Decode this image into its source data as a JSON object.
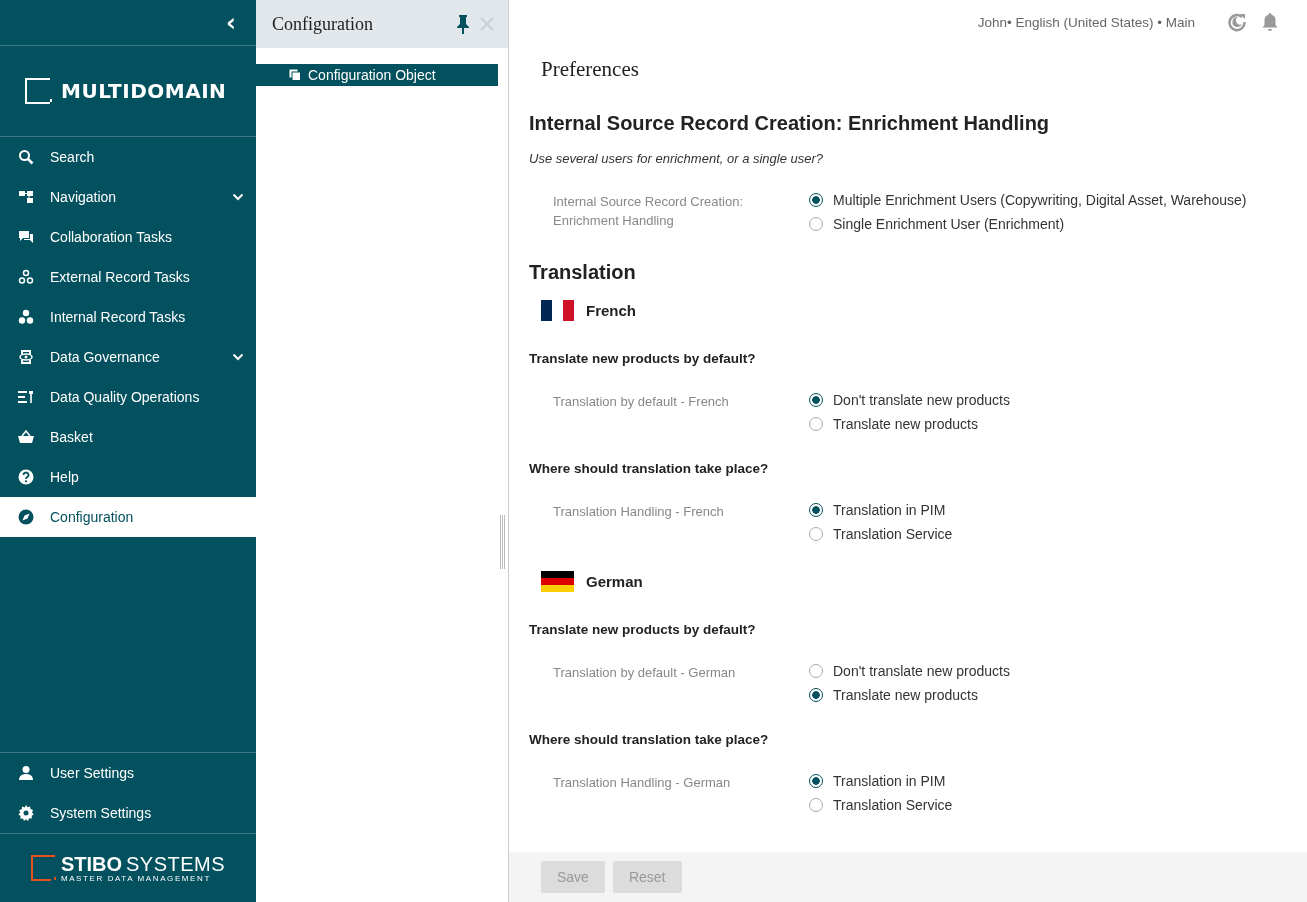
{
  "sidebar": {
    "collapse_glyph": "‹",
    "brand": "MULTIDOMAIN",
    "items": [
      {
        "label": "Search",
        "expandable": false,
        "selected": false
      },
      {
        "label": "Navigation",
        "expandable": true,
        "selected": false
      },
      {
        "label": "Collaboration Tasks",
        "expandable": false,
        "selected": false
      },
      {
        "label": "External Record Tasks",
        "expandable": false,
        "selected": false
      },
      {
        "label": "Internal Record Tasks",
        "expandable": false,
        "selected": false
      },
      {
        "label": "Data Governance",
        "expandable": true,
        "selected": false
      },
      {
        "label": "Data Quality Operations",
        "expandable": false,
        "selected": false
      },
      {
        "label": "Basket",
        "expandable": false,
        "selected": false
      },
      {
        "label": "Help",
        "expandable": false,
        "selected": false
      },
      {
        "label": "Configuration",
        "expandable": false,
        "selected": true
      }
    ],
    "bottom_items": [
      {
        "label": "User Settings"
      },
      {
        "label": "System Settings"
      }
    ],
    "footer_logo": {
      "primary": "STIBO",
      "secondary": "SYSTEMS",
      "tagline": "MASTER DATA MANAGEMENT"
    }
  },
  "panel": {
    "title": "Configuration",
    "pinned": true,
    "tree": [
      {
        "label": "Configuration Object",
        "selected": true
      }
    ]
  },
  "top_bar": {
    "context": "John• English (United States) • Main"
  },
  "page": {
    "title": "Preferences",
    "blocks": [
      {
        "kind": "heading",
        "text": "Internal Source Record Creation: Enrichment Handling"
      },
      {
        "kind": "description",
        "text": "Use several users for enrichment, or a single user?"
      },
      {
        "kind": "setting",
        "label": "Internal Source Record Creation: Enrichment Handling",
        "options": [
          {
            "label": "Multiple Enrichment Users (Copywriting, Digital Asset, Warehouse)",
            "selected": true
          },
          {
            "label": "Single Enrichment User (Enrichment)",
            "selected": false
          }
        ]
      },
      {
        "kind": "heading",
        "text": "Translation"
      },
      {
        "kind": "language",
        "text": "French"
      },
      {
        "kind": "question",
        "text": "Translate new products by default?"
      },
      {
        "kind": "setting",
        "label": "Translation by default - French",
        "options": [
          {
            "label": "Don't translate new products",
            "selected": true
          },
          {
            "label": "Translate new products",
            "selected": false
          }
        ]
      },
      {
        "kind": "question",
        "text": "Where should translation take place?"
      },
      {
        "kind": "setting",
        "label": "Translation Handling - French",
        "options": [
          {
            "label": "Translation in PIM",
            "selected": true
          },
          {
            "label": "Translation Service",
            "selected": false
          }
        ]
      },
      {
        "kind": "language",
        "text": "German"
      },
      {
        "kind": "question",
        "text": "Translate new products by default?"
      },
      {
        "kind": "setting",
        "label": "Translation by default - German",
        "options": [
          {
            "label": "Don't translate new products",
            "selected": false
          },
          {
            "label": "Translate new products",
            "selected": true
          }
        ]
      },
      {
        "kind": "question",
        "text": "Where should translation take place?"
      },
      {
        "kind": "setting",
        "label": "Translation Handling - German",
        "options": [
          {
            "label": "Translation in PIM",
            "selected": true
          },
          {
            "label": "Translation Service",
            "selected": false
          }
        ]
      }
    ]
  },
  "footer": {
    "buttons": [
      {
        "label": "Save",
        "disabled": true
      },
      {
        "label": "Reset",
        "disabled": true
      }
    ]
  }
}
